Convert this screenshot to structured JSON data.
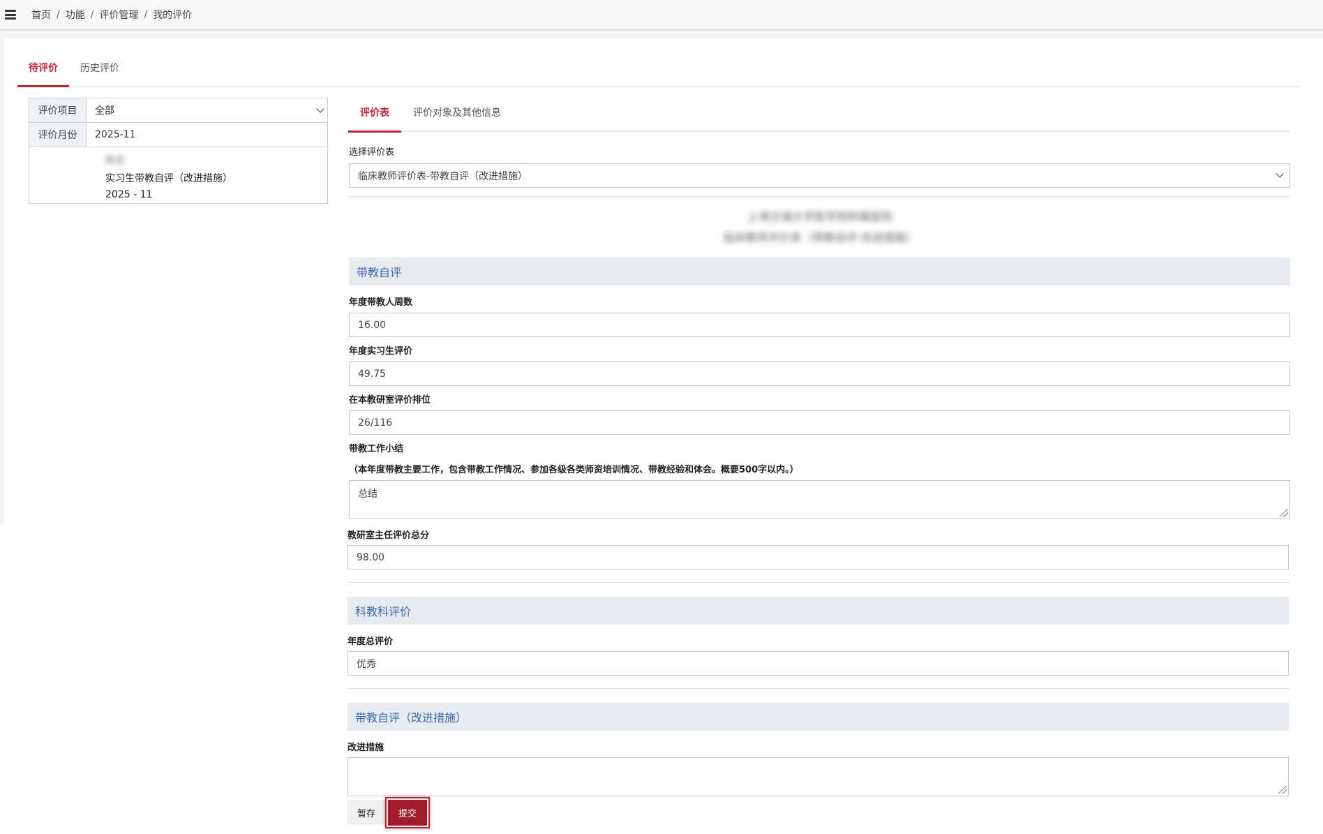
{
  "breadcrumb": [
    "首页",
    "功能",
    "评价管理",
    "我的评价"
  ],
  "main_tabs": [
    "待评价",
    "历史评价"
  ],
  "filter": {
    "project_label": "评价项目",
    "project_value": "全部",
    "month_label": "评价月份",
    "month_value": "2025-11",
    "list_item": {
      "name_blurred": "姓名",
      "title": "实习生带教自评（改进措施）",
      "month": "2025 - 11"
    }
  },
  "sub_tabs": [
    "评价表",
    "评价对象及其他信息"
  ],
  "form": {
    "select_label": "选择评价表",
    "select_value": "临床教师评价表-带教自评（改进措施）",
    "header_blurred_line1": "上海交通大学医学院附属医院",
    "header_blurred_line2": "临床教师评价表（带教自评·改进措施）"
  },
  "section1": {
    "title": "带教自评",
    "f1_label": "年度带教人周数",
    "f1_value": "16.00",
    "f2_label": "年度实习生评价",
    "f2_value": "49.75",
    "f3_label": "在本教研室评价排位",
    "f3_value": "26/116",
    "f4_label": "带教工作小结",
    "f4_hint": "（本年度带教主要工作，包含带教工作情况、参加各级各类师资培训情况、带教经验和体会。概要500字以内。）",
    "f4_value": "总结",
    "f5_label": "教研室主任评价总分",
    "f5_value": "98.00"
  },
  "section2": {
    "title": "科教科评价",
    "f1_label": "年度总评价",
    "f1_value": "优秀"
  },
  "section3": {
    "title": "带教自评（改进措施）",
    "f1_label": "改进措施",
    "f1_value": ""
  },
  "buttons": {
    "save": "暂存",
    "submit": "提交"
  }
}
